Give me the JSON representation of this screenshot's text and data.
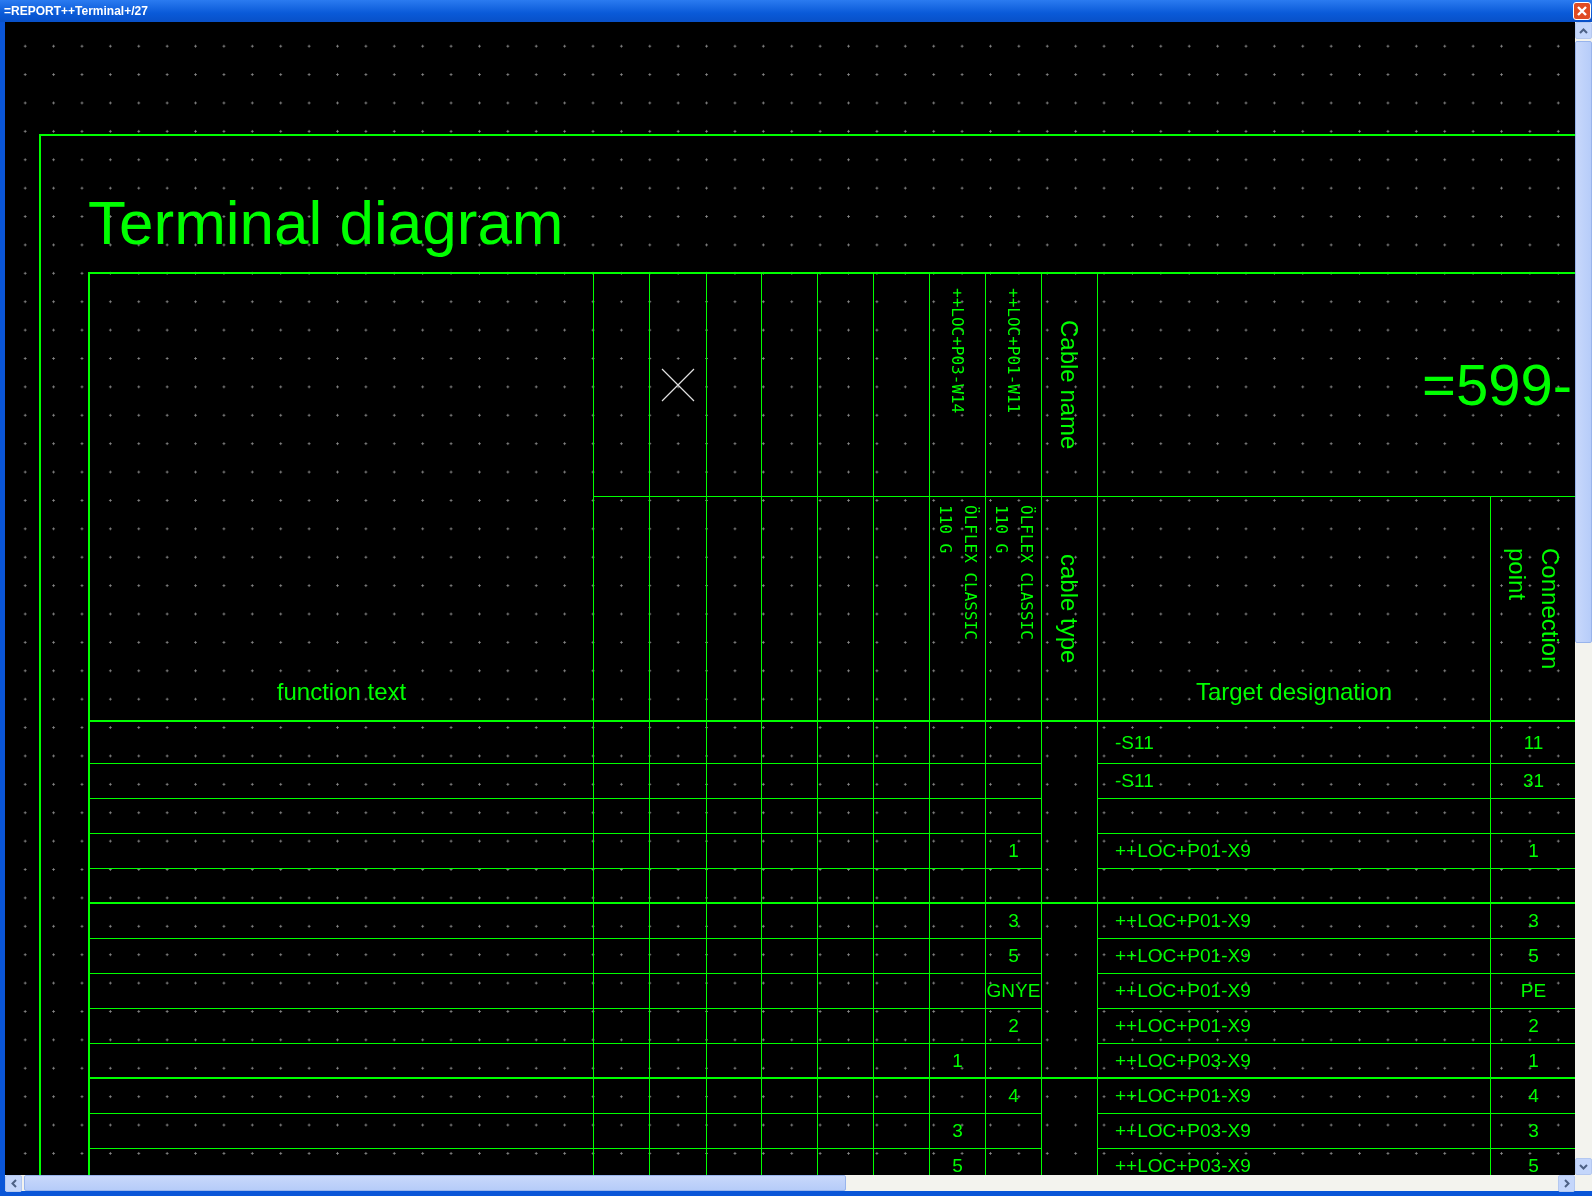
{
  "window": {
    "title": "=REPORT++Terminal+/27"
  },
  "drawing": {
    "title": "Terminal diagram",
    "header": {
      "function_text": "function text",
      "cable_name": "Cable name",
      "cable_type": "cable type",
      "strip": "=599-",
      "target_designation": "Target designation",
      "connection_point": "Connection\npoint",
      "cables": [
        {
          "name": "++LOC+P03-W14",
          "type": "ÖLFLEX CLASSIC\n110 G"
        },
        {
          "name": "++LOC+P01-W11",
          "type": "ÖLFLEX CLASSIC\n110 G"
        }
      ]
    },
    "groups": [
      {
        "rows": [
          {
            "target": "-S11",
            "point": "11"
          },
          {
            "target": "-S11",
            "point": "31"
          },
          {},
          {
            "core_2": "1",
            "target": "++LOC+P01-X9",
            "point": "1"
          },
          {}
        ]
      },
      {
        "rows": [
          {
            "core_2": "3",
            "target": "++LOC+P01-X9",
            "point": "3"
          },
          {
            "core_2": "5",
            "target": "++LOC+P01-X9",
            "point": "5"
          },
          {
            "core_2": "GNYE",
            "target": "++LOC+P01-X9",
            "point": "PE"
          },
          {
            "core_2": "2",
            "target": "++LOC+P01-X9",
            "point": "2"
          },
          {
            "core_1": "1",
            "target": "++LOC+P03-X9",
            "point": "1"
          }
        ]
      },
      {
        "rows": [
          {
            "core_2": "4",
            "target": "++LOC+P01-X9",
            "point": "4"
          },
          {
            "core_1": "3",
            "target": "++LOC+P03-X9",
            "point": "3"
          },
          {
            "core_1": "5",
            "target": "++LOC+P03-X9",
            "point": "5"
          }
        ]
      }
    ]
  }
}
